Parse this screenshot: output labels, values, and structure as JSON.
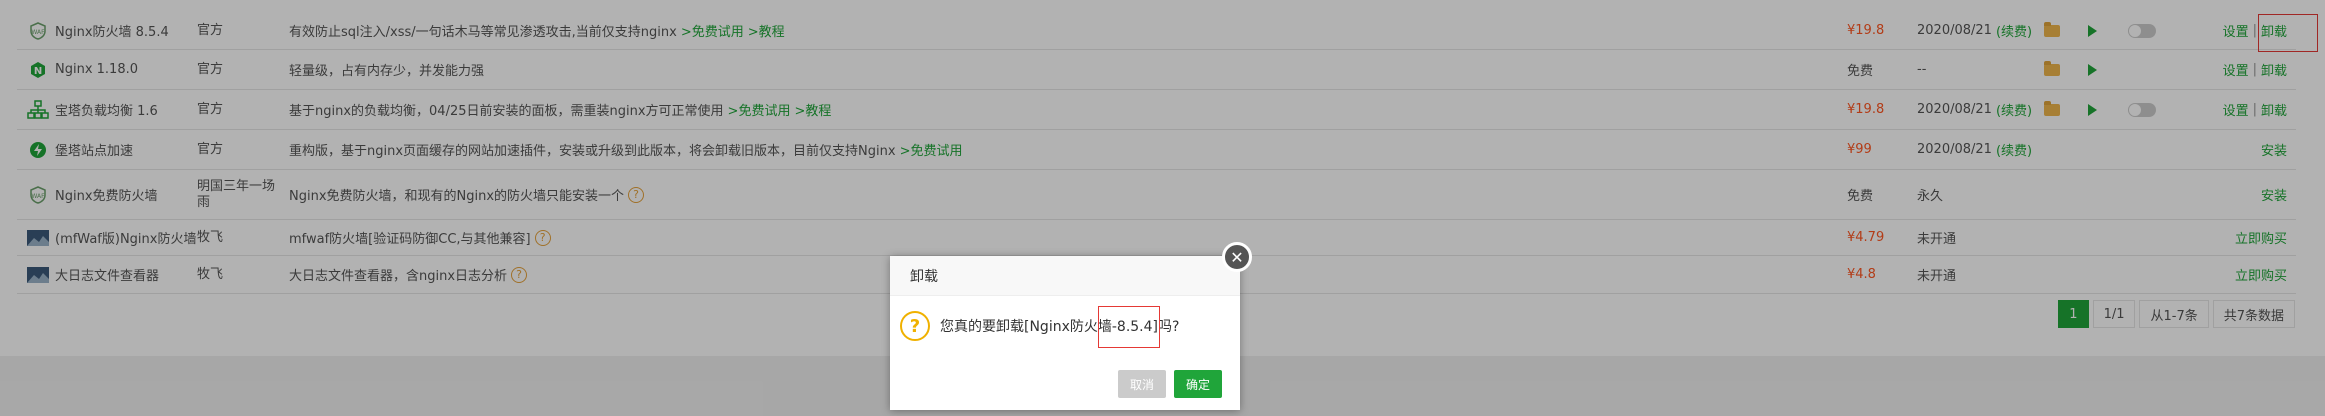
{
  "rows": [
    {
      "name": "Nginx防火墙 8.5.4",
      "dev": "官方",
      "desc": "有效防止sql注入/xss/一句话木马等常见渗透攻击,当前仅支持nginx",
      "links": [
        ">免费试用",
        ">教程"
      ],
      "price": "¥19.8",
      "expire": "2020/08/21",
      "renew": "(续费)",
      "ops": [
        "设置",
        "卸载"
      ],
      "icon": "shield-icon"
    },
    {
      "name": "Nginx 1.18.0",
      "dev": "官方",
      "desc": "轻量级，占有内存少，并发能力强",
      "links": [],
      "price": "免费",
      "expire": "--",
      "renew": "",
      "ops": [
        "设置",
        "卸载"
      ],
      "icon": "nginx-logo-icon"
    },
    {
      "name": "宝塔负载均衡 1.6",
      "dev": "官方",
      "desc": "基于nginx的负载均衡，04/25日前安装的面板，需重装nginx方可正常使用",
      "links": [
        ">免费试用",
        ">教程"
      ],
      "price": "¥19.8",
      "expire": "2020/08/21",
      "renew": "(续费)",
      "ops": [
        "设置",
        "卸载"
      ],
      "icon": "network-icon"
    },
    {
      "name": "堡塔站点加速",
      "dev": "官方",
      "desc": "重构版，基于nginx页面缓存的网站加速插件，安装或升级到此版本，将会卸载旧版本，目前仅支持Nginx",
      "links": [
        ">免费试用"
      ],
      "price": "¥99",
      "expire": "2020/08/21",
      "renew": "(续费)",
      "ops": [
        "安装"
      ],
      "icon": "lightning-icon"
    },
    {
      "name": "Nginx免费防火墙",
      "dev": "明国三年一场雨",
      "desc": "Nginx免费防火墙，和现有的Nginx的防火墙只能安装一个",
      "links": [],
      "price": "免费",
      "expire": "永久",
      "renew": "",
      "ops": [
        "安装"
      ],
      "icon": "shield-icon"
    },
    {
      "name": "(mfWaf版)Nginx防火墙",
      "dev": "牧飞",
      "desc": "mfwaf防火墙[验证码防御CC,与其他兼容]",
      "links": [],
      "price": "¥4.79",
      "expire": "未开通",
      "renew": "",
      "ops": [
        "立即购买"
      ],
      "icon": "picture-icon"
    },
    {
      "name": "大日志文件查看器",
      "dev": "牧飞",
      "desc": "大日志文件查看器，含nginx日志分析",
      "links": [],
      "price": "¥4.8",
      "expire": "未开通",
      "renew": "",
      "ops": [
        "立即购买"
      ],
      "icon": "picture-icon"
    }
  ],
  "pager": {
    "current": "1",
    "pages": "1/1",
    "range": "从1-7条",
    "total": "共7条数据"
  },
  "dialog": {
    "title": "卸载",
    "message_pre": "您真的要卸载[Nginx防火墙-8.5.4]吗?",
    "cancel": "取消",
    "ok": "确定",
    "close": "✕"
  },
  "colors": {
    "accent": "#20a53a",
    "price": "#ff5722",
    "highlight": "#e53935"
  }
}
